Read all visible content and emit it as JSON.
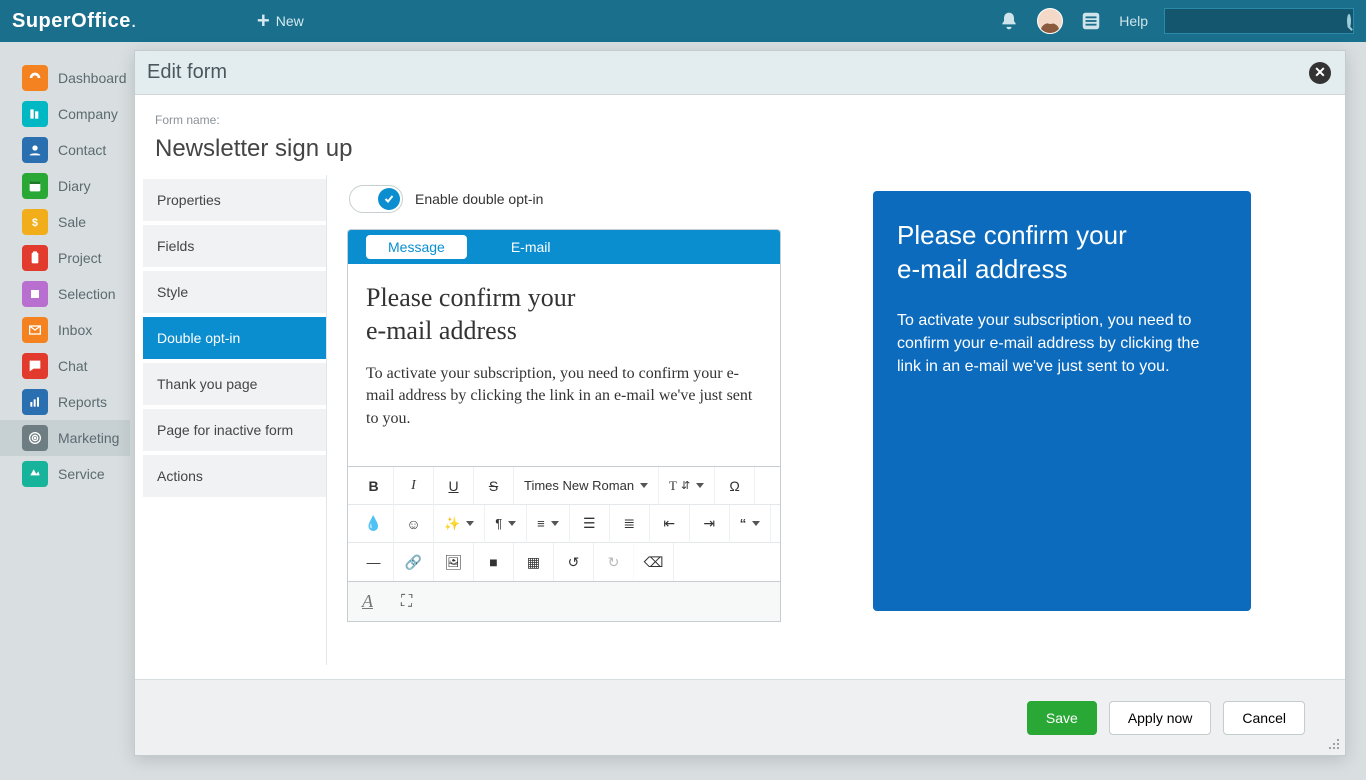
{
  "topbar": {
    "brand": "SuperOffice",
    "new_label": "New",
    "help_label": "Help",
    "search_placeholder": ""
  },
  "sidebar": {
    "items": [
      {
        "label": "Dashboard"
      },
      {
        "label": "Company"
      },
      {
        "label": "Contact"
      },
      {
        "label": "Diary"
      },
      {
        "label": "Sale"
      },
      {
        "label": "Project"
      },
      {
        "label": "Selection"
      },
      {
        "label": "Inbox"
      },
      {
        "label": "Chat"
      },
      {
        "label": "Reports"
      },
      {
        "label": "Marketing"
      },
      {
        "label": "Service"
      }
    ]
  },
  "modal": {
    "title": "Edit form",
    "form_name_label": "Form name:",
    "form_name_value": "Newsletter sign up",
    "side_tabs": [
      "Properties",
      "Fields",
      "Style",
      "Double opt-in",
      "Thank you page",
      "Page for inactive form",
      "Actions"
    ],
    "active_side_tab": "Double opt-in",
    "toggle_label": "Enable double opt-in",
    "msg_tabs": {
      "message": "Message",
      "email": "E-mail"
    },
    "editor": {
      "heading_l1": "Please confirm your",
      "heading_l2": "e-mail address",
      "body": "To activate your subscription, you need to confirm your e-mail address by clicking the link in an e-mail we've just sent to you."
    },
    "font_label": "Times New Roman",
    "preview": {
      "heading_l1": "Please confirm your",
      "heading_l2": "e-mail address",
      "body": "To activate your subscription, you need to confirm your e-mail address by clicking the link in an e-mail we've just sent to you."
    },
    "footer": {
      "save": "Save",
      "apply": "Apply now",
      "cancel": "Cancel"
    }
  }
}
